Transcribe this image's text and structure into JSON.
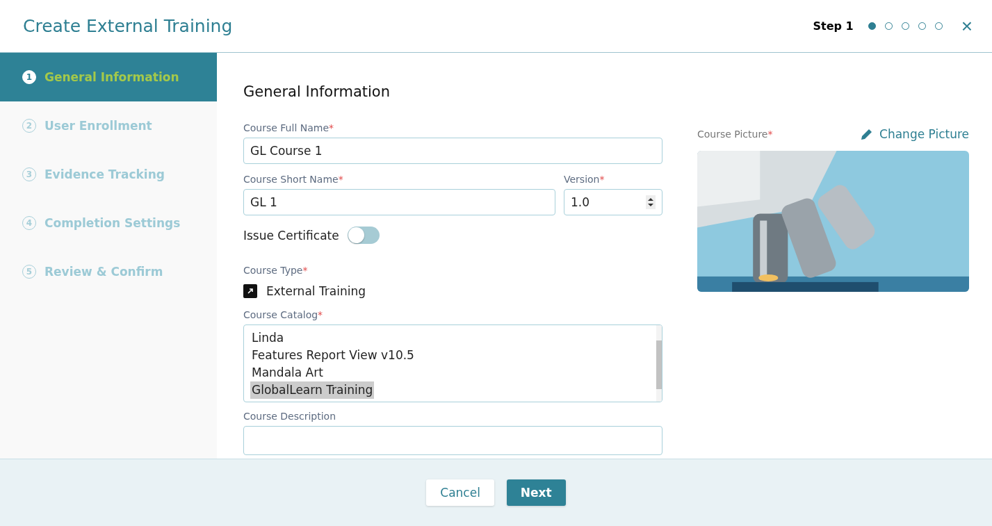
{
  "window": {
    "title": "Create External Training",
    "step_label": "Step 1",
    "step_dots": [
      {
        "selected": true
      },
      {
        "selected": false
      },
      {
        "selected": false
      },
      {
        "selected": false
      },
      {
        "selected": false
      }
    ],
    "close": "×"
  },
  "sidebar": {
    "items": [
      {
        "number": "1",
        "label": "General Information",
        "selected": true
      },
      {
        "number": "2",
        "label": "User Enrollment",
        "selected": false
      },
      {
        "number": "3",
        "label": "Evidence Tracking",
        "selected": false
      },
      {
        "number": "4",
        "label": "Completion Settings",
        "selected": false
      },
      {
        "number": "5",
        "label": "Review & Confirm",
        "selected": false
      }
    ]
  },
  "form": {
    "heading": "General Information",
    "required_mark": "*",
    "full_name": {
      "label": "Course Full Name",
      "value": "GL Course 1"
    },
    "short_name": {
      "label": "Course Short Name",
      "value": "GL 1"
    },
    "version": {
      "label": "Version",
      "value": "1.0"
    },
    "certificate": {
      "label": "Issue Certificate",
      "on": false
    },
    "course_type": {
      "label": "Course Type",
      "value": "External Training"
    },
    "catalog": {
      "label": "Course Catalog",
      "options": [
        {
          "label": "Linda",
          "selected": false
        },
        {
          "label": "Features Report View v10.5",
          "selected": false
        },
        {
          "label": "Mandala Art",
          "selected": false
        },
        {
          "label": "GlobalLearn Training",
          "selected": true
        }
      ]
    },
    "description": {
      "label": "Course Description"
    },
    "picture": {
      "label": "Course Picture",
      "change": "Change Picture"
    }
  },
  "footer": {
    "buttons": [
      {
        "label": "Cancel",
        "kind": "secondary"
      },
      {
        "label": "Next",
        "kind": "primary"
      }
    ]
  }
}
